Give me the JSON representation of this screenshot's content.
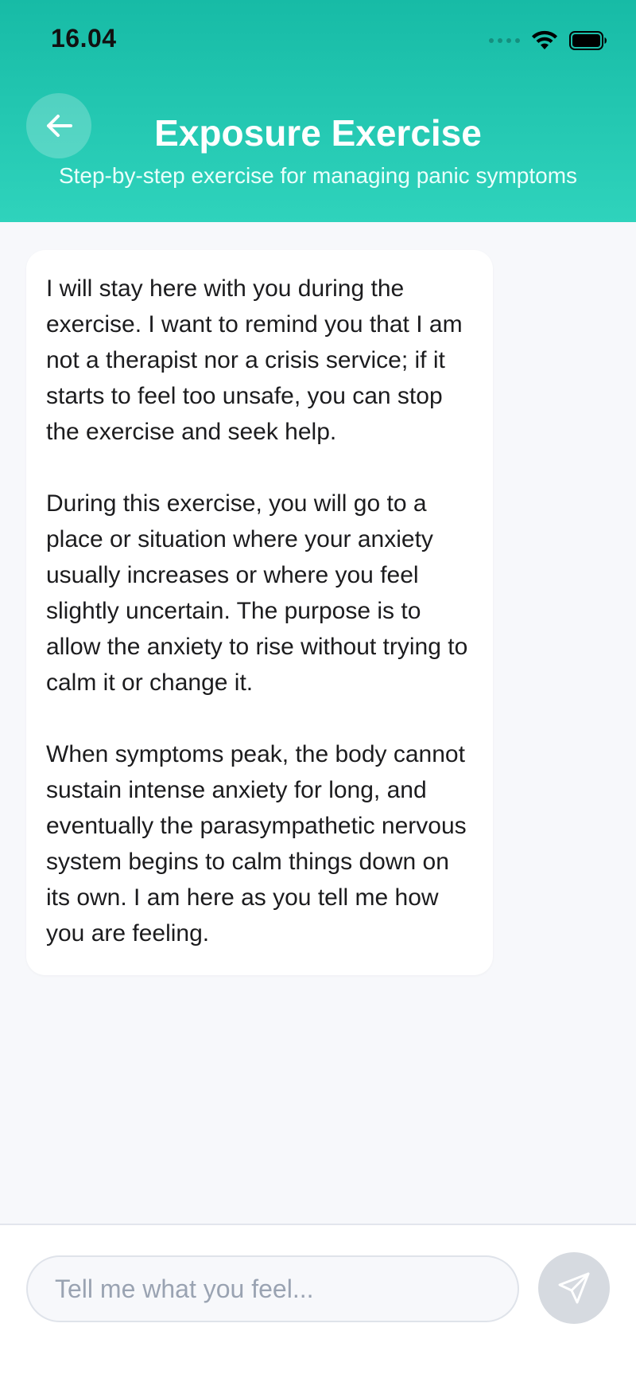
{
  "status_bar": {
    "time": "16.04",
    "icons": [
      "signal-dots-icon",
      "wifi-icon",
      "battery-icon"
    ]
  },
  "header": {
    "back_icon": "arrow-left-icon",
    "title": "Exposure Exercise",
    "subtitle": "Step-by-step exercise for managing panic symptoms"
  },
  "messages": [
    {
      "sender": "assistant",
      "paragraphs": [
        "I will stay here with you during the exercise. I want to remind you that I am not a therapist nor a crisis service; if it starts to feel too unsafe, you can stop the exercise and seek help.",
        "During this exercise, you will go to a place or situation where your anxiety usually increases or where you feel slightly uncertain. The purpose is to allow the anxiety to rise without trying to calm it or change it.",
        "When symptoms peak, the body cannot sustain intense anxiety for long, and eventually the parasympathetic nervous system begins to calm things down on its own. I am here as you tell me how you are feeling."
      ]
    }
  ],
  "composer": {
    "placeholder": "Tell me what you feel...",
    "value": "",
    "send_icon": "send-icon"
  },
  "colors": {
    "header_top": "#17bba6",
    "header_bottom": "#2fd3bc",
    "background": "#f7f8fb",
    "send_button_disabled": "#d6dae0"
  }
}
